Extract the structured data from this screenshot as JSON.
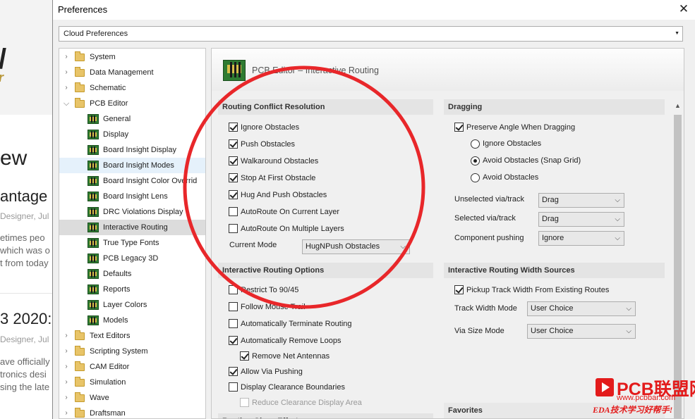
{
  "background_page": {
    "texts": [
      "ew",
      "antage",
      "Designer, Jul",
      "etimes peo",
      "which was o",
      "t from today",
      "3 2020:",
      "Designer, Jul",
      "ave officially",
      "tronics desi",
      "sing the late"
    ]
  },
  "dialog": {
    "title": "Preferences",
    "close_glyph": "✕",
    "cloud_select": "Cloud Preferences"
  },
  "tree": {
    "items": [
      {
        "label": "System",
        "kind": "folder",
        "expanded": false
      },
      {
        "label": "Data Management",
        "kind": "folder",
        "expanded": false
      },
      {
        "label": "Schematic",
        "kind": "folder",
        "expanded": false
      },
      {
        "label": "PCB Editor",
        "kind": "folder",
        "expanded": true
      },
      {
        "label": "General",
        "kind": "page"
      },
      {
        "label": "Display",
        "kind": "page"
      },
      {
        "label": "Board Insight Display",
        "kind": "page"
      },
      {
        "label": "Board Insight Modes",
        "kind": "page"
      },
      {
        "label": "Board Insight Color Overrid",
        "kind": "page"
      },
      {
        "label": "Board Insight Lens",
        "kind": "page"
      },
      {
        "label": "DRC Violations Display",
        "kind": "page"
      },
      {
        "label": "Interactive Routing",
        "kind": "page",
        "selected": true
      },
      {
        "label": "True Type Fonts",
        "kind": "page"
      },
      {
        "label": "PCB Legacy 3D",
        "kind": "page"
      },
      {
        "label": "Defaults",
        "kind": "page"
      },
      {
        "label": "Reports",
        "kind": "page"
      },
      {
        "label": "Layer Colors",
        "kind": "page"
      },
      {
        "label": "Models",
        "kind": "page"
      },
      {
        "label": "Text Editors",
        "kind": "folder",
        "expanded": false
      },
      {
        "label": "Scripting System",
        "kind": "folder",
        "expanded": false
      },
      {
        "label": "CAM Editor",
        "kind": "folder",
        "expanded": false
      },
      {
        "label": "Simulation",
        "kind": "folder",
        "expanded": false
      },
      {
        "label": "Wave",
        "kind": "folder",
        "expanded": false
      },
      {
        "label": "Draftsman",
        "kind": "folder",
        "expanded": false
      }
    ]
  },
  "panel": {
    "header_title": "PCB Editor – Interactive Routing",
    "conflict": {
      "title": "Routing Conflict Resolution",
      "options": [
        {
          "label": "Ignore Obstacles",
          "checked": true
        },
        {
          "label": "Push Obstacles",
          "checked": true
        },
        {
          "label": "Walkaround Obstacles",
          "checked": true
        },
        {
          "label": "Stop At First Obstacle",
          "checked": true
        },
        {
          "label": "Hug And Push Obstacles",
          "checked": true
        },
        {
          "label": "AutoRoute On Current Layer",
          "checked": false
        },
        {
          "label": "AutoRoute On Multiple Layers",
          "checked": false
        }
      ],
      "mode_label": "Current Mode",
      "mode_value": "HugNPush Obstacles"
    },
    "dragging": {
      "title": "Dragging",
      "preserve_angle": {
        "label": "Preserve Angle When Dragging",
        "checked": true
      },
      "radios": [
        {
          "label": "Ignore Obstacles",
          "checked": false
        },
        {
          "label": "Avoid Obstacles (Snap Grid)",
          "checked": true
        },
        {
          "label": "Avoid Obstacles",
          "checked": false
        }
      ],
      "fields": [
        {
          "label": "Unselected via/track",
          "value": "Drag"
        },
        {
          "label": "Selected via/track",
          "value": "Drag"
        },
        {
          "label": "Component pushing",
          "value": "Ignore"
        }
      ]
    },
    "routing_options": {
      "title": "Interactive Routing Options",
      "options": [
        {
          "label": "Restrict To 90/45",
          "checked": false,
          "disabled": false
        },
        {
          "label": "Follow Mouse Trail",
          "checked": false,
          "disabled": false
        },
        {
          "label": "Automatically Terminate Routing",
          "checked": false,
          "disabled": false
        },
        {
          "label": "Automatically Remove Loops",
          "checked": true,
          "disabled": false
        },
        {
          "label": "Remove Net Antennas",
          "checked": true,
          "disabled": false
        },
        {
          "label": "Allow Via Pushing",
          "checked": true,
          "disabled": false
        },
        {
          "label": "Display Clearance Boundaries",
          "checked": false,
          "disabled": false
        },
        {
          "label": "Reduce Clearance Display Area",
          "checked": false,
          "disabled": true
        }
      ],
      "next_section": "Routing Gloss Effort"
    },
    "width_sources": {
      "title": "Interactive Routing Width Sources",
      "pickup": {
        "label": "Pickup Track Width From Existing Routes",
        "checked": true
      },
      "fields": [
        {
          "label": "Track Width Mode",
          "value": "User Choice"
        },
        {
          "label": "Via Size Mode",
          "value": "User Choice"
        }
      ]
    },
    "favorites_title": "Favorites"
  },
  "annotation": {
    "color": "#e8272a"
  },
  "watermark": {
    "brand": "PCB联盟网",
    "url": "www.pcbbar.com",
    "tagline": "EDA技术学习好帮手!"
  }
}
